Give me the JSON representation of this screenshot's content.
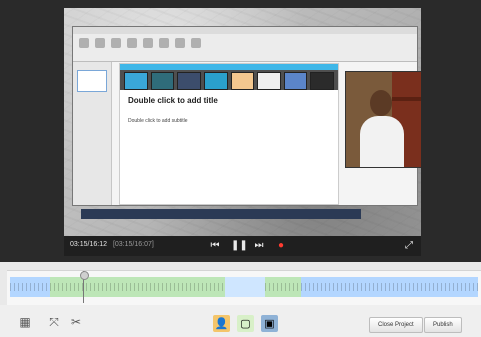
{
  "preview": {
    "inner_slide": {
      "title_placeholder": "Double click to add title",
      "subtitle_placeholder": "Double click to add subtitle"
    },
    "control_bar": {
      "current_time": "03:15/16:12",
      "duration_hint": "[03:15/16:07]"
    }
  },
  "timeline": {
    "colors": {
      "video": "#b3d6ff",
      "green": "#bde6b7",
      "blue": "#cfe6ff"
    }
  },
  "bottom_bar": {
    "buttons": {
      "close_project": "Close Project",
      "publish": "Publish"
    }
  }
}
